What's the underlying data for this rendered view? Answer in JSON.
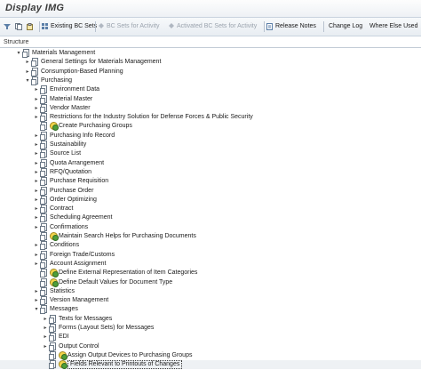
{
  "window": {
    "title": "Display IMG"
  },
  "toolbar": {
    "existing_bc_sets": "Existing BC Sets",
    "bc_sets_for_activity": "BC Sets for Activity",
    "activated_bc_sets": "Activated BC Sets for Activity",
    "release_notes": "Release Notes",
    "change_log": "Change Log",
    "where_else_used": "Where Else Used"
  },
  "structure_label": "Structure",
  "tree": [
    {
      "label": "Materials Management",
      "depth": 0,
      "arrow": "open",
      "icon": "doc"
    },
    {
      "label": "General Settings for Materials Management",
      "depth": 1,
      "arrow": "closed",
      "icon": "doc"
    },
    {
      "label": "Consumption-Based Planning",
      "depth": 1,
      "arrow": "closed",
      "icon": "doc"
    },
    {
      "label": "Purchasing",
      "depth": 1,
      "arrow": "open",
      "icon": "doc"
    },
    {
      "label": "Environment Data",
      "depth": 2,
      "arrow": "closed",
      "icon": "doc"
    },
    {
      "label": "Material Master",
      "depth": 2,
      "arrow": "closed",
      "icon": "doc"
    },
    {
      "label": "Vendor Master",
      "depth": 2,
      "arrow": "closed",
      "icon": "doc"
    },
    {
      "label": "Restrictions for the Industry Solution for Defense Forces & Public Security",
      "depth": 2,
      "arrow": "closed",
      "icon": "doc"
    },
    {
      "label": "Create Purchasing Groups",
      "depth": 2,
      "arrow": "none",
      "icon": "doc-clock"
    },
    {
      "label": "Purchasing Info Record",
      "depth": 2,
      "arrow": "closed",
      "icon": "doc"
    },
    {
      "label": "Sustainability",
      "depth": 2,
      "arrow": "closed",
      "icon": "doc"
    },
    {
      "label": "Source List",
      "depth": 2,
      "arrow": "closed",
      "icon": "doc"
    },
    {
      "label": "Quota Arrangement",
      "depth": 2,
      "arrow": "closed",
      "icon": "doc"
    },
    {
      "label": "RFQ/Quotation",
      "depth": 2,
      "arrow": "closed",
      "icon": "doc"
    },
    {
      "label": "Purchase Requisition",
      "depth": 2,
      "arrow": "closed",
      "icon": "doc"
    },
    {
      "label": "Purchase Order",
      "depth": 2,
      "arrow": "closed",
      "icon": "doc"
    },
    {
      "label": "Order Optimizing",
      "depth": 2,
      "arrow": "closed",
      "icon": "doc"
    },
    {
      "label": "Contract",
      "depth": 2,
      "arrow": "closed",
      "icon": "doc"
    },
    {
      "label": "Scheduling Agreement",
      "depth": 2,
      "arrow": "closed",
      "icon": "doc"
    },
    {
      "label": "Confirmations",
      "depth": 2,
      "arrow": "closed",
      "icon": "doc"
    },
    {
      "label": "Maintain Search Helps for Purchasing Documents",
      "depth": 2,
      "arrow": "none",
      "icon": "doc-clock"
    },
    {
      "label": "Conditions",
      "depth": 2,
      "arrow": "closed",
      "icon": "doc"
    },
    {
      "label": "Foreign Trade/Customs",
      "depth": 2,
      "arrow": "closed",
      "icon": "doc"
    },
    {
      "label": "Account Assignment",
      "depth": 2,
      "arrow": "closed",
      "icon": "doc"
    },
    {
      "label": "Define External Representation of Item Categories",
      "depth": 2,
      "arrow": "none",
      "icon": "doc-clock"
    },
    {
      "label": "Define Default Values for Document Type",
      "depth": 2,
      "arrow": "none",
      "icon": "doc-clock"
    },
    {
      "label": "Statistics",
      "depth": 2,
      "arrow": "closed",
      "icon": "doc"
    },
    {
      "label": "Version Management",
      "depth": 2,
      "arrow": "closed",
      "icon": "doc"
    },
    {
      "label": "Messages",
      "depth": 2,
      "arrow": "open",
      "icon": "doc"
    },
    {
      "label": "Texts for Messages",
      "depth": 3,
      "arrow": "closed",
      "icon": "doc"
    },
    {
      "label": "Forms (Layout Sets) for Messages",
      "depth": 3,
      "arrow": "closed",
      "icon": "doc"
    },
    {
      "label": "EDI",
      "depth": 3,
      "arrow": "closed",
      "icon": "doc"
    },
    {
      "label": "Output Control",
      "depth": 3,
      "arrow": "closed",
      "icon": "doc"
    },
    {
      "label": "Assign Output Devices to Purchasing Groups",
      "depth": 3,
      "arrow": "none",
      "icon": "doc-clock"
    },
    {
      "label": "Fields Relevant to Printouts of Changes",
      "depth": 3,
      "arrow": "none",
      "icon": "doc-clock",
      "selected": true
    }
  ]
}
